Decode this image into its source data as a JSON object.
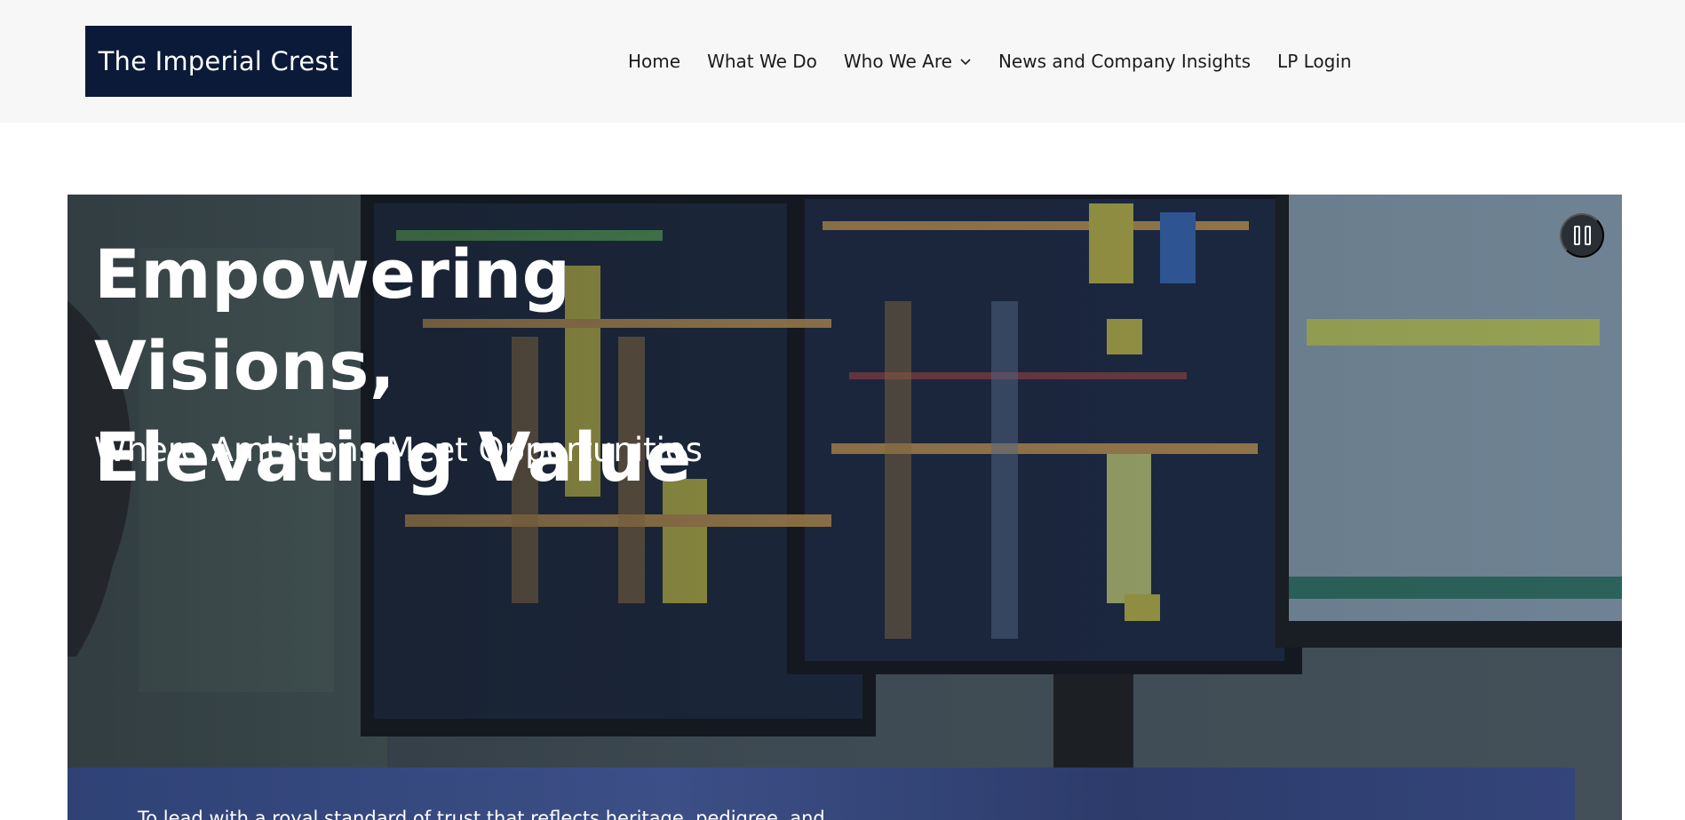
{
  "header": {
    "logo_text": "The Imperial Crest",
    "nav": [
      {
        "label": "Home"
      },
      {
        "label": "What We Do"
      },
      {
        "label": "Who We Are",
        "has_dropdown": true
      },
      {
        "label": "News and Company Insights"
      },
      {
        "label": "LP Login"
      }
    ]
  },
  "hero": {
    "title_line1": "Empowering Visions,",
    "title_line2": "Elevating Value",
    "subtitle": "Where Ambitions Meet Opportunities",
    "pause_icon": "pause-icon",
    "background_description_icon": "trading-monitors-photo"
  },
  "mission": {
    "text": "To lead with a royal standard of trust that reflects heritage, pedigree, and"
  },
  "colors": {
    "logo_bg": "#0b1a38",
    "header_bg": "#f7f7f7",
    "mission_bg": "#34457b",
    "text_light": "#ffffff",
    "nav_text": "#1b1b1b"
  }
}
